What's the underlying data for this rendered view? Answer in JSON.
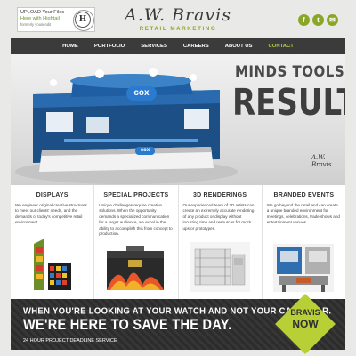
{
  "upload": {
    "line1": "UPLOAD Your Files",
    "line2": "Here with Hightail",
    "line3": "formerly yousendit",
    "badge": "H"
  },
  "logo": {
    "name": "A.W. Bravis",
    "tagline": "RETAIL MARKETING"
  },
  "social": [
    {
      "icon": "facebook-icon",
      "glyph": "f"
    },
    {
      "icon": "twitter-icon",
      "glyph": "t"
    },
    {
      "icon": "email-icon",
      "glyph": "✉"
    }
  ],
  "nav": {
    "items": [
      "HOME",
      "PORTFOLIO",
      "SERVICES",
      "CAREERS",
      "ABOUT US",
      "CONTACT"
    ],
    "active_index": 5
  },
  "hero": {
    "heading_small": "MINDS TOOLS",
    "heading_large": "RESULTS",
    "booth_logo": "cox",
    "signature": "A.W. Bravis"
  },
  "columns": [
    {
      "title": "DISPLAYS",
      "body": "We engineer original creative structures to meet our clients' needs, and the demands of today's competitive retail environment."
    },
    {
      "title": "SPECIAL PROJECTS",
      "body": "Unique challenges require creative solutions. When the opportunity demands a specialized communication for a target audience, we excel in the ability to accomplish this from concept to production."
    },
    {
      "title": "3D RENDERINGS",
      "body": "Our experienced team of 3D artists can create an extremely accurate rendering of any product or display without incurring time and resources for mock ups or prototypes."
    },
    {
      "title": "BRANDED EVENTS",
      "body": "We go beyond the retail and can create a unique branded environment for meetings, celebrations, trade shows and entertainment venues."
    }
  ],
  "banner": {
    "line1": "WHEN YOU'RE LOOKING AT YOUR WATCH AND NOT YOUR CALENDAR.",
    "line2": "WE'RE HERE TO SAVE THE DAY.",
    "line3": "24 HOUR PROJECT DEADLINE SERVICE",
    "badge_line1": "BRAVIS",
    "badge_line2": "NOW"
  },
  "colors": {
    "accent": "#8aa628",
    "nav_bg": "#3b3b3b",
    "nav_active": "#b6cf3a",
    "banner_bg": "#2f2f2f",
    "badge": "#b9cf36"
  }
}
